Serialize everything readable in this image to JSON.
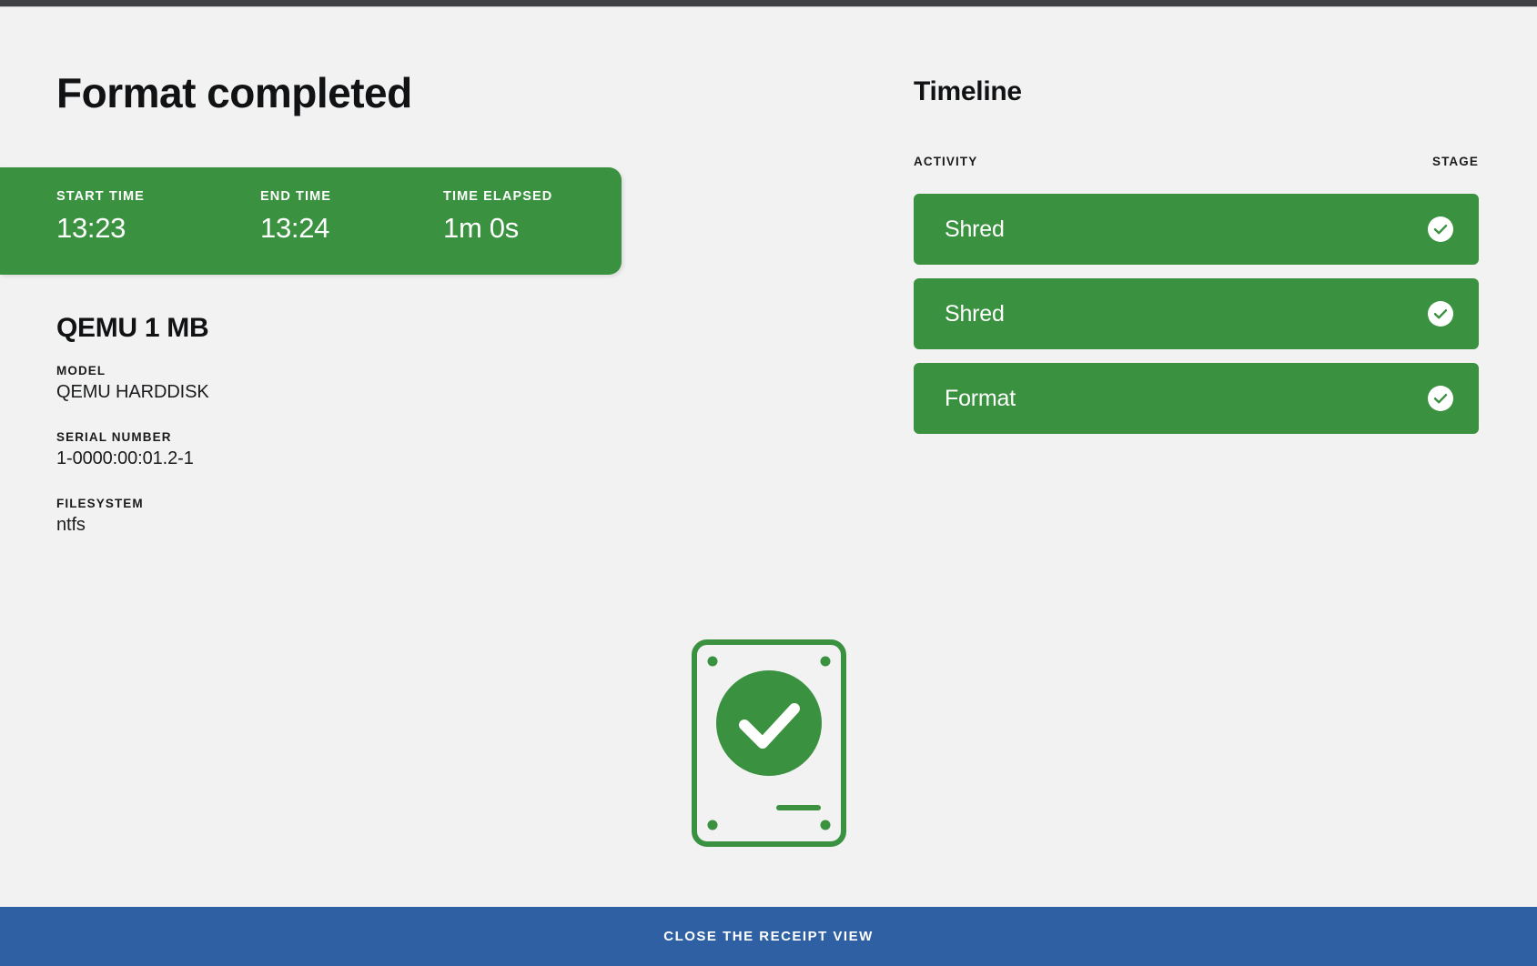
{
  "window": {
    "chrome_color": "#3f4145",
    "background_color": "#f2f2f2"
  },
  "colors": {
    "green": "#3a913f",
    "blue": "#2e60a3",
    "text": "#111214"
  },
  "header": {
    "title": "Format completed"
  },
  "stats": {
    "items": [
      {
        "label": "START TIME",
        "value": "13:23"
      },
      {
        "label": "END TIME",
        "value": "13:24"
      },
      {
        "label": "TIME ELAPSED",
        "value": "1m 0s"
      }
    ]
  },
  "device": {
    "name": "QEMU 1 MB",
    "fields": [
      {
        "label": "MODEL",
        "value": "QEMU HARDDISK"
      },
      {
        "label": "SERIAL NUMBER",
        "value": "1-0000:00:01.2-1"
      },
      {
        "label": "FILESYSTEM",
        "value": "ntfs"
      }
    ]
  },
  "timeline": {
    "title": "Timeline",
    "columns": {
      "activity": "ACTIVITY",
      "stage": "STAGE"
    },
    "rows": [
      {
        "activity": "Shred",
        "stage_icon": "check-circle-icon",
        "status": "completed"
      },
      {
        "activity": "Shred",
        "stage_icon": "check-circle-icon",
        "status": "completed"
      },
      {
        "activity": "Format",
        "stage_icon": "check-circle-icon",
        "status": "completed"
      }
    ]
  },
  "illustration": {
    "icon": "hard-disk-success-icon",
    "status": "success"
  },
  "footer": {
    "close_label": "CLOSE THE RECEIPT VIEW"
  }
}
